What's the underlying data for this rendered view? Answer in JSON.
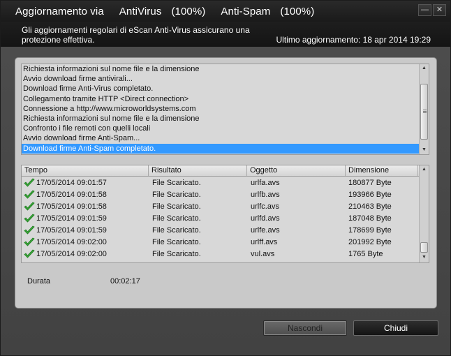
{
  "titlebar": {
    "app": "Aggiornamento via",
    "av_label": "AntiVirus",
    "av_pct": "(100%)",
    "as_label": "Anti-Spam",
    "as_pct": "(100%)",
    "minimize": "—",
    "close": "✕"
  },
  "header": {
    "description": "Gli aggiornamenti regolari di eScan Anti-Virus assicurano una protezione effettiva.",
    "last_update": "Ultimo aggiornamento: 18 apr 2014 19:29"
  },
  "log": [
    "Richiesta informazioni sul nome file e la dimensione",
    "Avvio download firme antivirali...",
    "Download firme Anti-Virus completato.",
    "Collegamento tramite HTTP <Direct connection>",
    "Connessione a http://www.microworldsystems.com",
    "Richiesta informazioni sul nome file e la dimensione",
    "Confronto i file remoti con quelli locali",
    "Avvio download firme Anti-Spam...",
    "Download firme Anti-Spam completato."
  ],
  "table": {
    "headers": [
      "Tempo",
      "Risultato",
      "Oggetto",
      "Dimensione"
    ],
    "rows": [
      [
        "17/05/2014 09:01:57",
        "File Scaricato.",
        "urlfa.avs",
        "180877 Byte"
      ],
      [
        "17/05/2014 09:01:58",
        "File Scaricato.",
        "urlfb.avs",
        "193966 Byte"
      ],
      [
        "17/05/2014 09:01:58",
        "File Scaricato.",
        "urlfc.avs",
        "210463 Byte"
      ],
      [
        "17/05/2014 09:01:59",
        "File Scaricato.",
        "urlfd.avs",
        "187048 Byte"
      ],
      [
        "17/05/2014 09:01:59",
        "File Scaricato.",
        "urlfe.avs",
        "178699 Byte"
      ],
      [
        "17/05/2014 09:02:00",
        "File Scaricato.",
        "urlff.avs",
        "201992 Byte"
      ],
      [
        "17/05/2014 09:02:00",
        "File Scaricato.",
        "vul.avs",
        "1765 Byte"
      ]
    ]
  },
  "duration": {
    "label": "Durata",
    "value": "00:02:17"
  },
  "buttons": {
    "hide": "Nascondi",
    "close": "Chiudi"
  }
}
